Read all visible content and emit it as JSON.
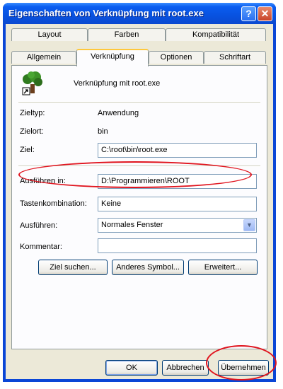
{
  "window": {
    "title": "Eigenschaften von Verknüpfung mit root.exe",
    "help_label": "?",
    "close_label": "✕"
  },
  "tabs": {
    "row_back": [
      "Layout",
      "Farben",
      "Kompatibilität"
    ],
    "row_front": [
      "Allgemein",
      "Verknüpfung",
      "Optionen",
      "Schriftart"
    ],
    "active": "Verknüpfung"
  },
  "shortcut": {
    "name": "Verknüpfung mit root.exe",
    "icon": "tree-icon",
    "fields": {
      "zieltyp_label": "Zieltyp:",
      "zieltyp_value": "Anwendung",
      "zielort_label": "Zielort:",
      "zielort_value": "bin",
      "ziel_label": "Ziel:",
      "ziel_value": "C:\\root\\bin\\root.exe",
      "ausfuehren_in_label": "Ausführen in:",
      "ausfuehren_in_value": "D:\\Programmieren\\ROOT",
      "tastenkombination_label": "Tastenkombination:",
      "tastenkombination_value": "Keine",
      "ausfuehren_label": "Ausführen:",
      "ausfuehren_value": "Normales Fenster",
      "kommentar_label": "Kommentar:",
      "kommentar_value": ""
    },
    "buttons": {
      "ziel_suchen": "Ziel suchen...",
      "anderes_symbol": "Anderes Symbol...",
      "erweitert": "Erweitert..."
    }
  },
  "dialog_buttons": {
    "ok": "OK",
    "abbrechen": "Abbrechen",
    "uebernehmen": "Übernehmen"
  },
  "annotation_color": "#e0141e"
}
